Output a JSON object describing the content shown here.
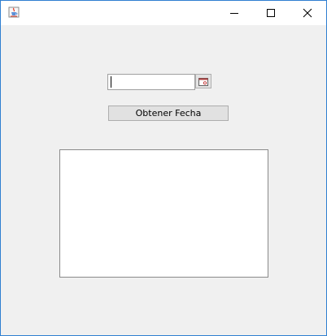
{
  "window": {
    "icons": {
      "app": "java-coffee-cup-icon",
      "minimize": "minimize-icon",
      "maximize": "maximize-icon",
      "close": "close-icon"
    }
  },
  "form": {
    "date_field_value": "",
    "calendar_button_icon": "calendar-icon",
    "get_date_button_label": "Obtener Fecha",
    "result_text": ""
  },
  "colors": {
    "window_border": "#2f7fd1",
    "background": "#f0f0f0",
    "titlebar": "#ffffff"
  }
}
